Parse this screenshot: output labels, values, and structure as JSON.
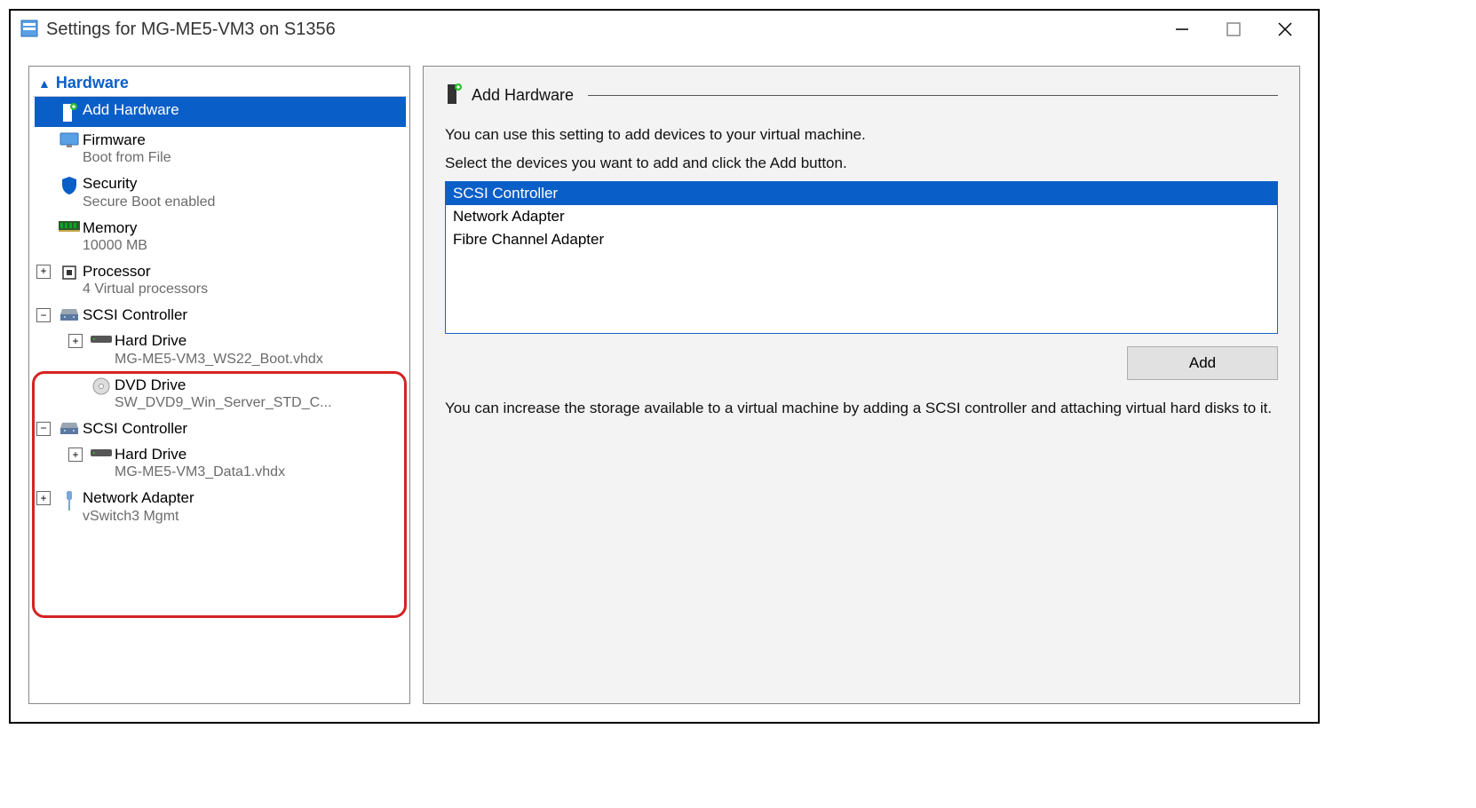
{
  "window": {
    "title": "Settings for MG-ME5-VM3 on S1356"
  },
  "left": {
    "section": "Hardware",
    "items": [
      {
        "id": "add-hardware",
        "label": "Add Hardware",
        "selected": true,
        "icon": "tower-add"
      },
      {
        "id": "firmware",
        "label": "Firmware",
        "sub": "Boot from File",
        "icon": "monitor"
      },
      {
        "id": "security",
        "label": "Security",
        "sub": "Secure Boot enabled",
        "icon": "shield"
      },
      {
        "id": "memory",
        "label": "Memory",
        "sub": "10000 MB",
        "icon": "ram"
      },
      {
        "id": "processor",
        "label": "Processor",
        "sub": "4 Virtual processors",
        "icon": "cpu",
        "expander": "plus"
      },
      {
        "id": "scsi1",
        "label": "SCSI Controller",
        "icon": "scsi",
        "expander": "minus",
        "children": [
          {
            "id": "hd1",
            "label": "Hard Drive",
            "sub": "MG-ME5-VM3_WS22_Boot.vhdx",
            "icon": "hdd",
            "expander": "plus"
          },
          {
            "id": "dvd1",
            "label": "DVD Drive",
            "sub": "SW_DVD9_Win_Server_STD_C...",
            "icon": "dvd"
          }
        ]
      },
      {
        "id": "scsi2",
        "label": "SCSI Controller",
        "icon": "scsi",
        "expander": "minus",
        "children": [
          {
            "id": "hd2",
            "label": "Hard Drive",
            "sub": "MG-ME5-VM3_Data1.vhdx",
            "icon": "hdd",
            "expander": "plus"
          }
        ]
      },
      {
        "id": "netadapter",
        "label": "Network Adapter",
        "sub": "vSwitch3 Mgmt",
        "icon": "nic",
        "expander": "plus"
      }
    ]
  },
  "right": {
    "heading": "Add Hardware",
    "desc1": "You can use this setting to add devices to your virtual machine.",
    "desc2": "Select the devices you want to add and click the Add button.",
    "devices": [
      {
        "label": "SCSI Controller",
        "selected": true
      },
      {
        "label": "Network Adapter"
      },
      {
        "label": "Fibre Channel Adapter"
      }
    ],
    "add_button": "Add",
    "desc3": "You can increase the storage available to a virtual machine by adding a SCSI controller and attaching virtual hard disks to it."
  }
}
